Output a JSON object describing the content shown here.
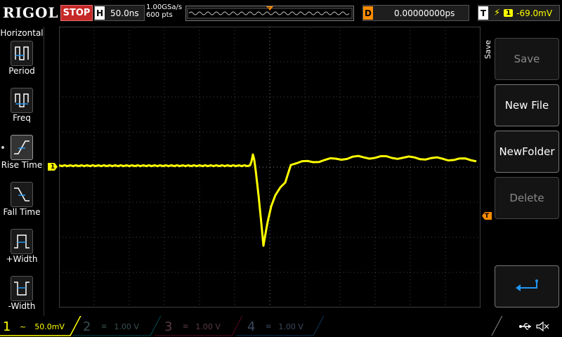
{
  "header": {
    "logo": "RIGOL",
    "run_state": "STOP",
    "timebase_tag": "H",
    "timebase": "50.0ns",
    "sample_rate": "1.00GSa/s",
    "memory_depth": "600 pts",
    "delay_tag": "D",
    "delay": "0.00000000ps",
    "trigger_tag": "T",
    "trigger_channel": "1",
    "trigger_level": "-69.0mV"
  },
  "left_menu": {
    "title": "Horizontal",
    "items": [
      {
        "label": "Period",
        "icon": "period-icon"
      },
      {
        "label": "Freq",
        "icon": "freq-icon"
      },
      {
        "label": "Rise Time",
        "icon": "rise-time-icon"
      },
      {
        "label": "Fall Time",
        "icon": "fall-time-icon"
      },
      {
        "label": "+Width",
        "icon": "plus-width-icon"
      },
      {
        "label": "-Width",
        "icon": "minus-width-icon"
      }
    ]
  },
  "right_menu": {
    "title": "Save",
    "buttons": [
      "Save",
      "New File",
      "NewFolder",
      "Delete"
    ],
    "enter_icon": "enter-icon"
  },
  "channels": [
    {
      "num": "1",
      "scale": "50.0mV",
      "color": "#ffff00",
      "active": true
    },
    {
      "num": "2",
      "scale": "1.00 V",
      "color": "#00bcd4",
      "active": false
    },
    {
      "num": "3",
      "scale": "1.00 V",
      "color": "#d81b60",
      "active": false
    },
    {
      "num": "4",
      "scale": "1.00 V",
      "color": "#1e88e5",
      "active": false
    }
  ],
  "markers": {
    "ch1": "1",
    "trigger": "T"
  },
  "colors": {
    "ch1": "#ffff00",
    "stop": "#c62828",
    "accent": "#ff8c00",
    "grid": "#555555"
  },
  "status_icons": [
    "usb-icon",
    "speaker-muted-icon"
  ]
}
